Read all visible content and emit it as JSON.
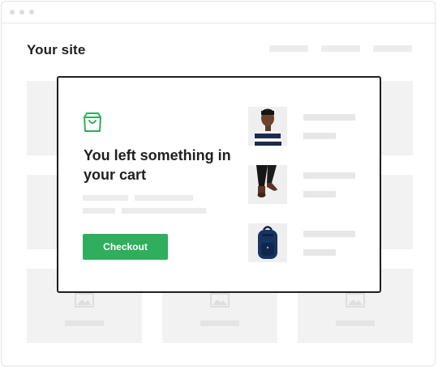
{
  "site": {
    "title": "Your site"
  },
  "modal": {
    "headline": "You left something in your cart",
    "checkout_label": "Checkout",
    "accent_color": "#2fae5d"
  },
  "cart_items": [
    {
      "image": "man-striped-sweater"
    },
    {
      "image": "black-pants-brown-shoes"
    },
    {
      "image": "navy-backpack"
    }
  ],
  "icons": [
    "shopping-bag-icon",
    "image-placeholder-icon"
  ]
}
